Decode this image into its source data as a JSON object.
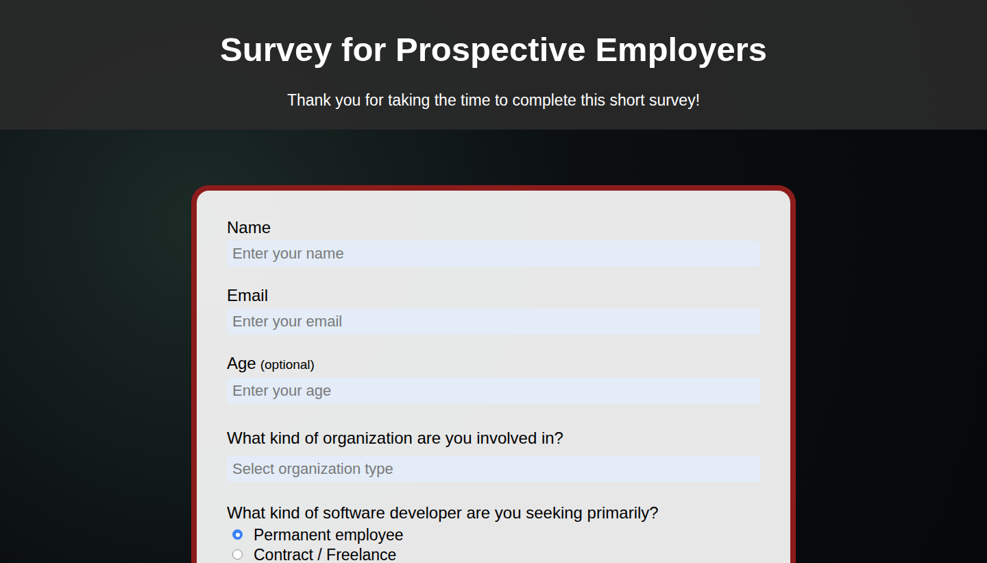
{
  "header": {
    "title": "Survey for Prospective Employers",
    "subtitle": "Thank you for taking the time to complete this short survey!"
  },
  "fields": [
    {
      "kind": "input",
      "label": "Name",
      "note": "",
      "placeholder": "Enter your name"
    },
    {
      "kind": "input",
      "label": "Email",
      "note": "",
      "placeholder": "Enter your email"
    },
    {
      "kind": "input",
      "label": "Age",
      "note": "(optional)",
      "placeholder": "Enter your age"
    },
    {
      "kind": "select",
      "label": "What kind of organization are you involved in?",
      "note": "",
      "placeholder": "Select organization type"
    }
  ],
  "developer_question": {
    "label": "What kind of software developer are you seeking primarily?",
    "options": [
      {
        "label": "Permanent employee",
        "selected": true
      },
      {
        "label": "Contract / Freelance",
        "selected": false
      }
    ]
  }
}
